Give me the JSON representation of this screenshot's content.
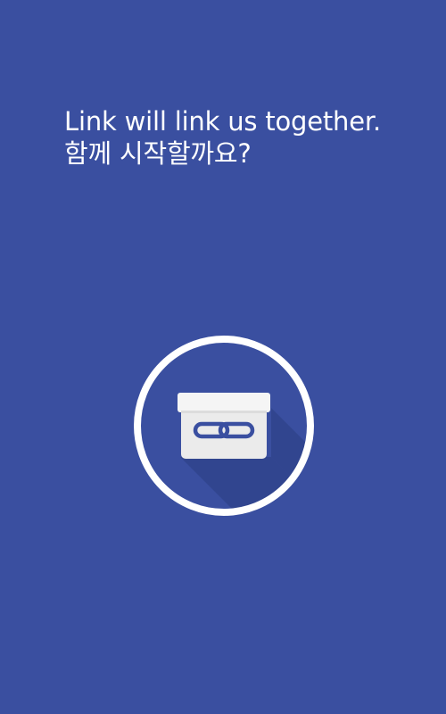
{
  "colors": {
    "background": "#3a4fa0",
    "ring": "#ffffff",
    "box_lid": "#f2f2f2",
    "box_body": "#ebebeb",
    "link_accent": "#3a4fa0",
    "shadow": "#2f4189"
  },
  "intro": {
    "line1": "Link will link us together.",
    "line2": "함께 시작할까요?"
  },
  "logo": {
    "icon": "link-box-icon"
  }
}
